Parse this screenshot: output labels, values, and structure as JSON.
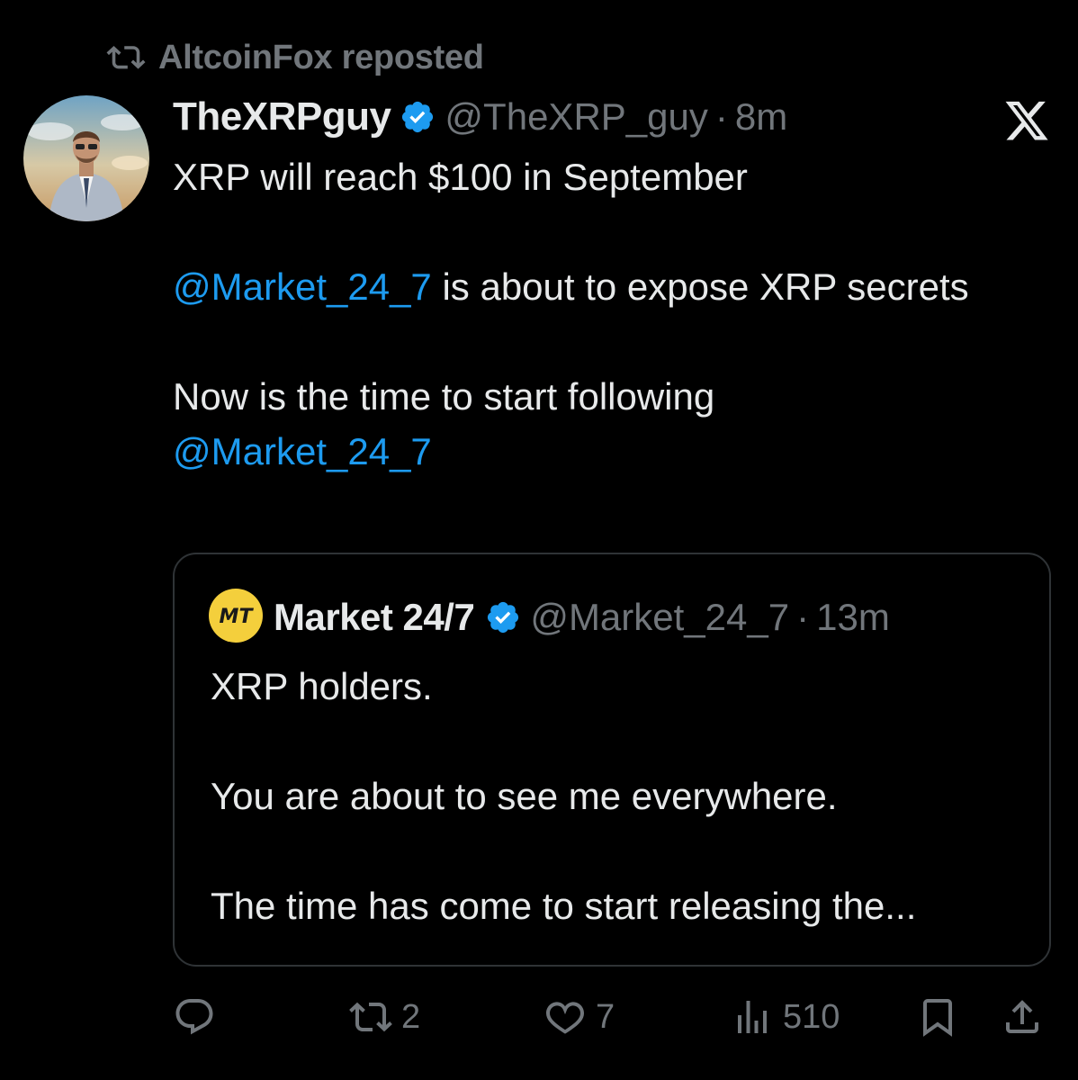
{
  "repost": {
    "label": "AltcoinFox reposted"
  },
  "tweet": {
    "name": "TheXRPguy",
    "handle": "@TheXRP_guy",
    "separator": "·",
    "time": "8m",
    "line1": "XRP will reach $100 in September",
    "mention_a": "@Market_24_7",
    "line2_rest": " is about to expose XRP secrets",
    "line3": "Now is the time to start following",
    "mention_b": "@Market_24_7"
  },
  "quote": {
    "name": "Market 24/7",
    "handle": "@Market_24_7",
    "separator": "·",
    "time": "13m",
    "line1": "XRP holders.",
    "line2": "You are about to see me everywhere.",
    "line3": "The time has come to start releasing the..."
  },
  "actions": {
    "reposts": "2",
    "likes": "7",
    "views": "510"
  },
  "icons": {
    "repost": "repost-icon",
    "verified": "verified-badge-icon",
    "x_logo": "x-logo-icon",
    "reply": "reply-icon",
    "like": "heart-icon",
    "views": "views-icon",
    "bookmark": "bookmark-icon",
    "share": "share-icon"
  },
  "colors": {
    "accent": "#1d9bf0",
    "muted": "#71767b",
    "text": "#e7e9ea",
    "background": "#000000"
  }
}
